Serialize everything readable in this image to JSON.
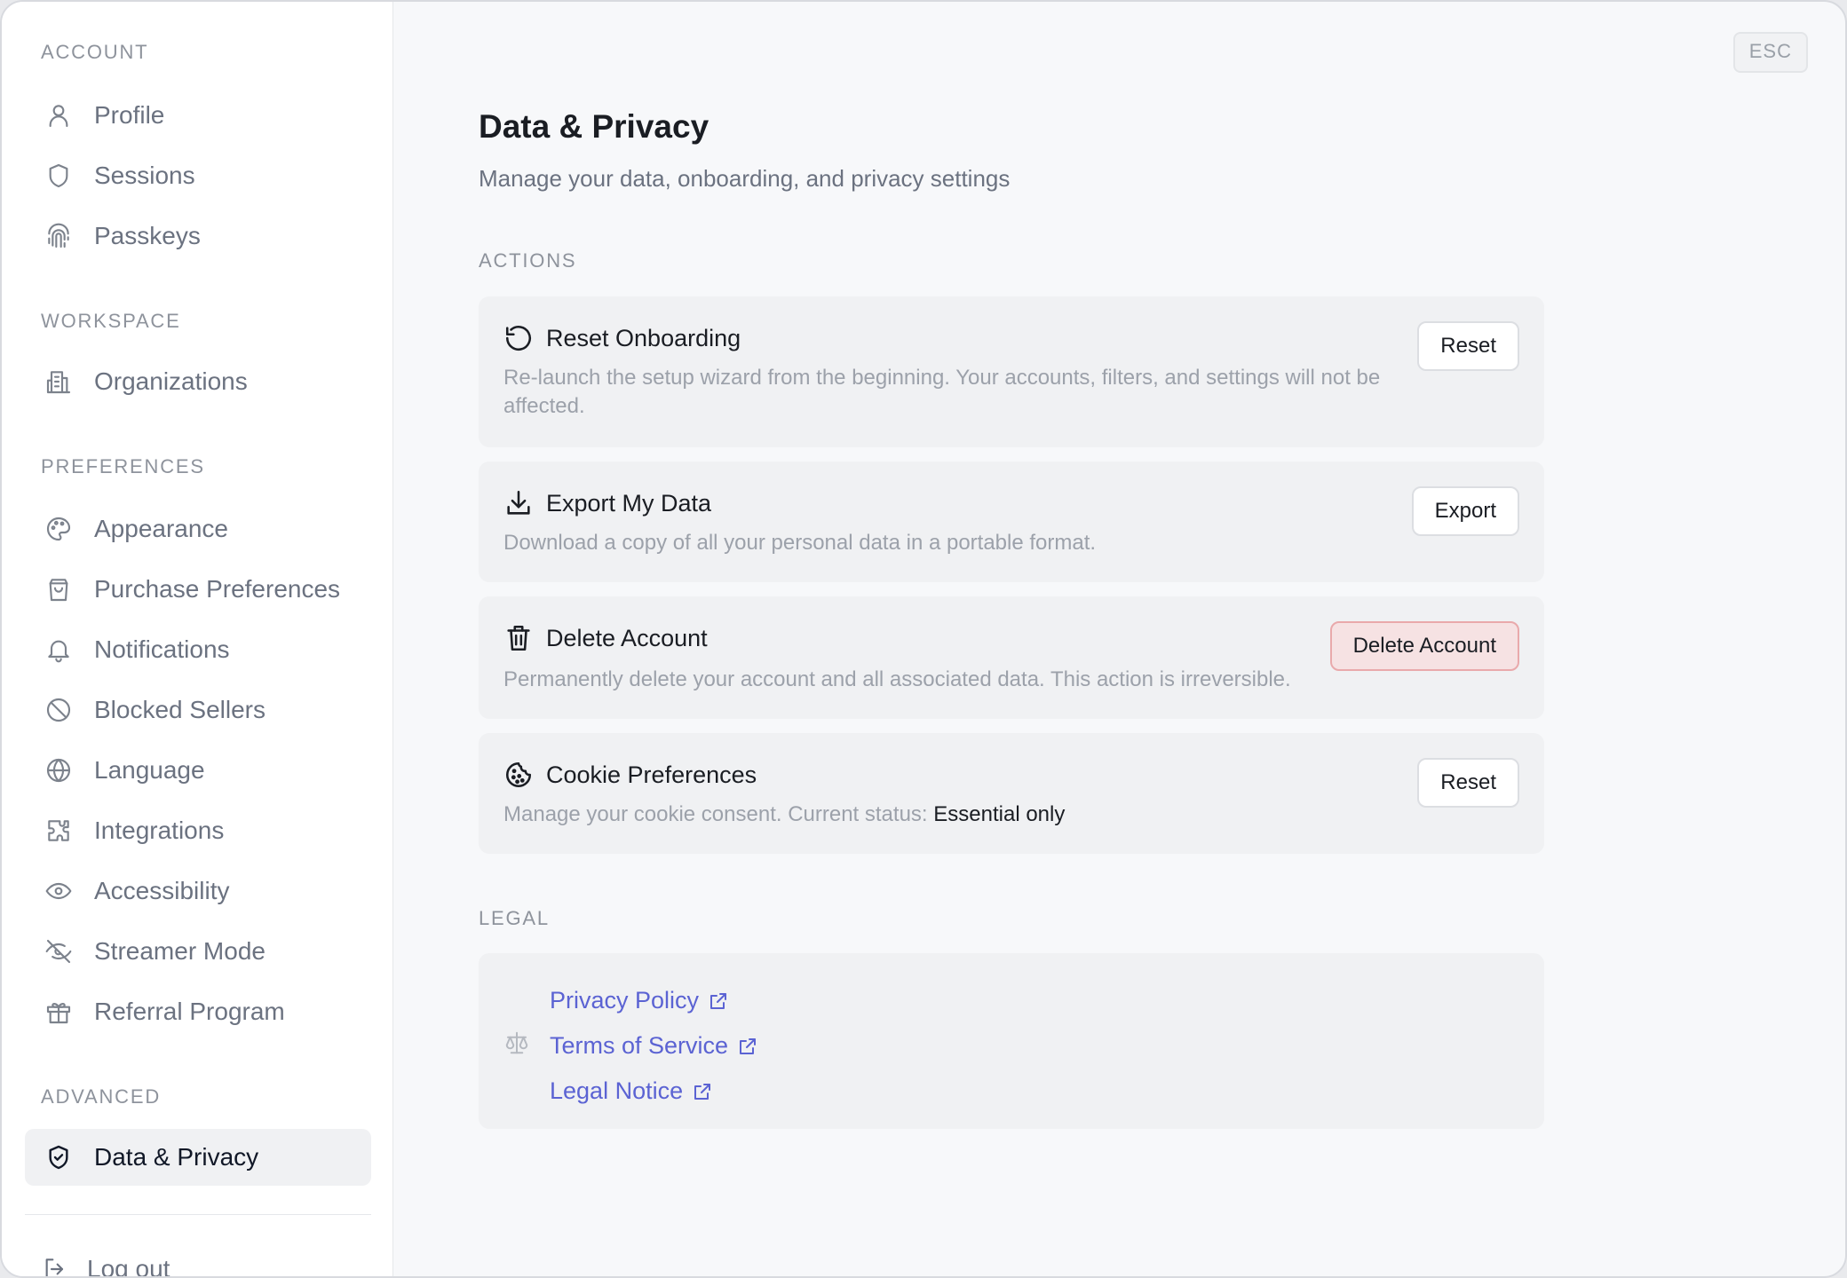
{
  "sidebar": {
    "sections": {
      "account": "ACCOUNT",
      "workspace": "WORKSPACE",
      "preferences": "PREFERENCES",
      "advanced": "ADVANCED"
    },
    "items": {
      "profile": {
        "label": "Profile",
        "icon": "user-icon"
      },
      "sessions": {
        "label": "Sessions",
        "icon": "shield-icon"
      },
      "passkeys": {
        "label": "Passkeys",
        "icon": "fingerprint-icon"
      },
      "organizations": {
        "label": "Organizations",
        "icon": "building-icon"
      },
      "appearance": {
        "label": "Appearance",
        "icon": "palette-icon"
      },
      "purchase_preferences": {
        "label": "Purchase Preferences",
        "icon": "shopping-bag-icon"
      },
      "notifications": {
        "label": "Notifications",
        "icon": "bell-icon"
      },
      "blocked_sellers": {
        "label": "Blocked Sellers",
        "icon": "ban-icon"
      },
      "language": {
        "label": "Language",
        "icon": "globe-icon"
      },
      "integrations": {
        "label": "Integrations",
        "icon": "puzzle-icon"
      },
      "accessibility": {
        "label": "Accessibility",
        "icon": "eye-icon"
      },
      "streamer_mode": {
        "label": "Streamer Mode",
        "icon": "eye-off-icon"
      },
      "referral_program": {
        "label": "Referral Program",
        "icon": "gift-icon"
      },
      "data_privacy": {
        "label": "Data & Privacy",
        "icon": "shield-check-icon",
        "active": true
      }
    },
    "logout": {
      "label": "Log out",
      "icon": "logout-icon"
    }
  },
  "header": {
    "esc_label": "ESC",
    "title": "Data & Privacy",
    "subtitle": "Manage your data, onboarding, and privacy settings"
  },
  "actions": {
    "label": "ACTIONS",
    "reset_onboarding": {
      "title": "Reset Onboarding",
      "icon": "rotate-ccw-icon",
      "description_line1": "Re-launch the setup wizard from the beginning. Your accounts, filters, and settings will not be",
      "description_line2": "affected.",
      "button": "Reset"
    },
    "export_data": {
      "title": "Export My Data",
      "icon": "download-icon",
      "description": "Download a copy of all your personal data in a portable format.",
      "button": "Export"
    },
    "delete_account": {
      "title": "Delete Account",
      "icon": "trash-icon",
      "description": "Permanently delete your account and all associated data. This action is irreversible.",
      "button": "Delete Account"
    },
    "cookie_preferences": {
      "title": "Cookie Preferences",
      "icon": "cookie-icon",
      "description_prefix": "Manage your cookie consent. Current status:",
      "status": "Essential only",
      "button": "Reset"
    }
  },
  "legal": {
    "label": "LEGAL",
    "icon": "scale-icon",
    "links": {
      "privacy_policy": "Privacy Policy",
      "terms_of_service": "Terms of Service",
      "legal_notice": "Legal Notice"
    }
  },
  "colors": {
    "accent_link": "#5b63d3",
    "danger_bg": "#f6e2e3",
    "danger_border": "#e9a9ab"
  }
}
